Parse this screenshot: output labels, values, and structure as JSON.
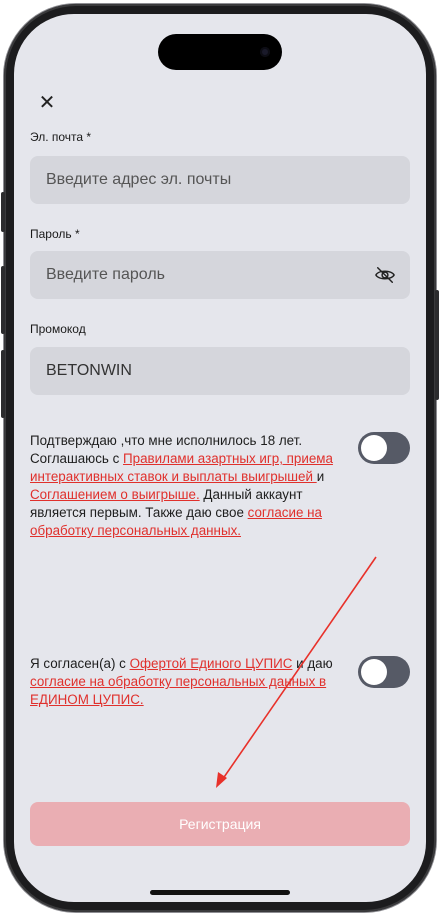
{
  "form": {
    "email": {
      "label": "Эл. почта *",
      "placeholder": "Введите адрес эл. почты"
    },
    "password": {
      "label": "Пароль *",
      "placeholder": "Введите пароль"
    },
    "promo": {
      "label": "Промокод",
      "value": "BETONWIN"
    }
  },
  "consent1": {
    "text1": "Подтверждаю ,что мне исполнилось 18 лет. Соглашаюсь с ",
    "link1": "Правилами азартных игр, приема интерактивных ставок и выплаты выигрышей ",
    "text2": "и ",
    "link2": "Соглашением о выигрыше.",
    "text3": " Данный аккаунт является первым. Также даю свое ",
    "link3": "согласие на обработку персональных данных."
  },
  "consent2": {
    "text1": "Я согласен(а) с ",
    "link1": "Офертой Единого ЦУПИС",
    "text2": " и даю ",
    "link2": "согласие на обработку персональных данных в ЕДИНОМ ЦУПИС."
  },
  "submit_label": "Регистрация",
  "colors": {
    "accent": "#e0302c",
    "button_disabled": "#eaaeb3",
    "toggle_off": "#565a66",
    "background": "#e5e6ec"
  }
}
